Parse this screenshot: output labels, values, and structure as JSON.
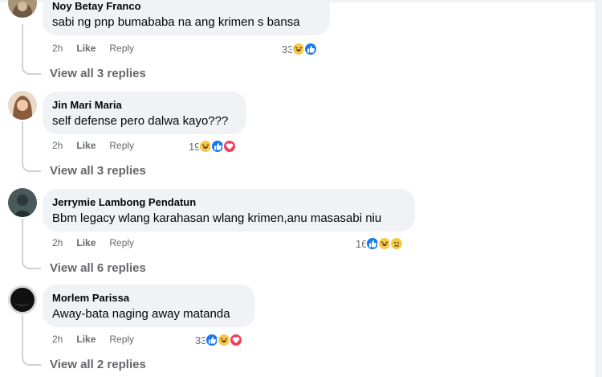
{
  "comments": [
    {
      "author": "Noy Betay Franco",
      "text": "sabi ng pnp bumababa na ang krimen s bansa",
      "time": "2h",
      "like_label": "Like",
      "reply_label": "Reply",
      "reaction_count": "33",
      "reactions": [
        "haha-icon",
        "like-icon"
      ],
      "view_replies": "View all 3 replies"
    },
    {
      "author": "Jin Mari Maria",
      "text": "self defense pero dalwa kayo???",
      "time": "2h",
      "like_label": "Like",
      "reply_label": "Reply",
      "reaction_count": "19",
      "reactions": [
        "haha-icon",
        "like-icon",
        "love-icon"
      ],
      "view_replies": "View all 3 replies"
    },
    {
      "author": "Jerrymie Lambong Pendatun",
      "text": "Bbm legacy wlang karahasan wlang krimen,anu masasabi niu",
      "time": "2h",
      "like_label": "Like",
      "reply_label": "Reply",
      "reaction_count": "16",
      "reactions": [
        "like-icon",
        "haha-icon",
        "sad-icon"
      ],
      "view_replies": "View all 6 replies"
    },
    {
      "author": "Morlem Parissa",
      "text": "Away-bata naging away matanda",
      "time": "2h",
      "like_label": "Like",
      "reply_label": "Reply",
      "reaction_count": "33",
      "reactions": [
        "like-icon",
        "haha-icon",
        "love-icon"
      ],
      "view_replies": "View all 2 replies"
    }
  ],
  "colors": {
    "bubble": "#f0f2f5",
    "meta_text": "#65676b",
    "like_blue": "#1877f2",
    "haha_yellow": "#f7c948",
    "love_red": "#f33e58"
  }
}
